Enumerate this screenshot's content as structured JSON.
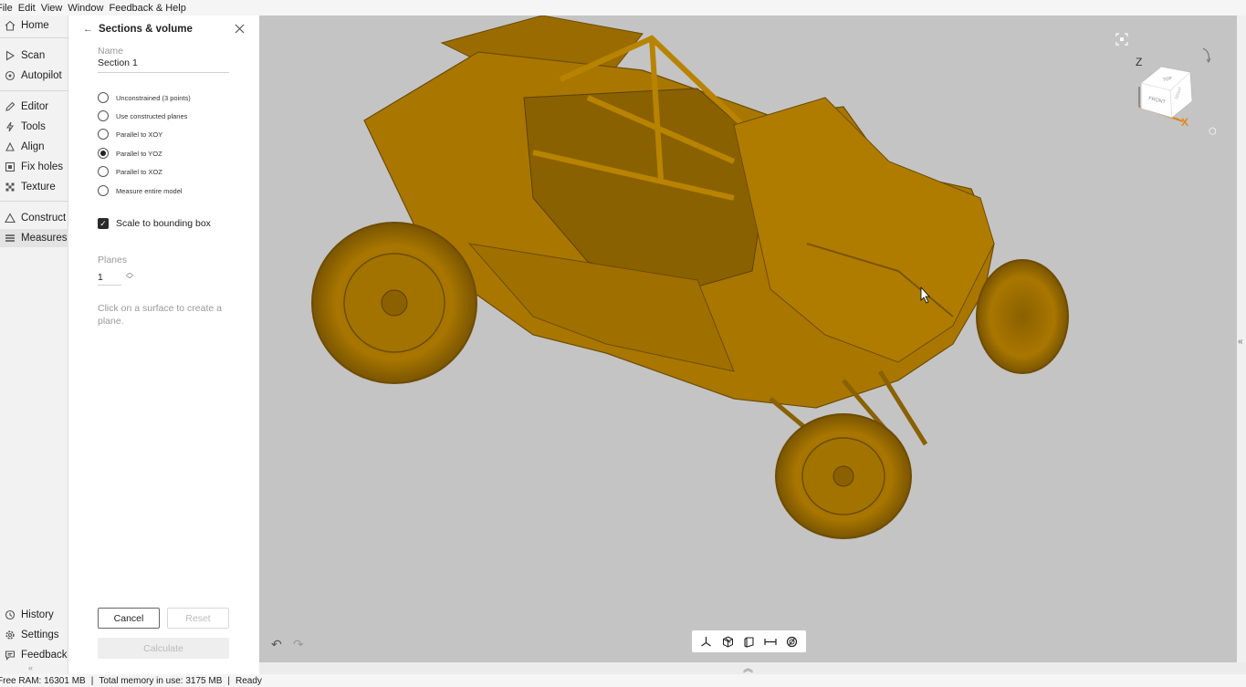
{
  "menu": {
    "items": [
      "File",
      "Edit",
      "View",
      "Window",
      "Feedback & Help"
    ]
  },
  "nav": {
    "home": "Home",
    "scan": "Scan",
    "autopilot": "Autopilot",
    "editor": "Editor",
    "tools": "Tools",
    "align": "Align",
    "fix_holes": "Fix holes",
    "texture": "Texture",
    "construct": "Construct",
    "measures": "Measures",
    "history": "History",
    "settings": "Settings",
    "feedback": "Feedback",
    "active": "Measures"
  },
  "panel": {
    "title": "Sections & volume",
    "name_label": "Name",
    "name_value": "Section 1",
    "options": [
      {
        "label": "Unconstrained (3 points)",
        "checked": false
      },
      {
        "label": "Use constructed planes",
        "checked": false
      },
      {
        "label": "Parallel to XOY",
        "checked": false
      },
      {
        "label": "Parallel to YOZ",
        "checked": true
      },
      {
        "label": "Parallel to XOZ",
        "checked": false
      },
      {
        "label": "Measure entire model",
        "checked": false
      }
    ],
    "scale_label": "Scale to bounding box",
    "scale_checked": true,
    "planes_label": "Planes",
    "planes_value": "1",
    "hint": "Click on a surface to create a plane.",
    "cancel": "Cancel",
    "reset": "Reset",
    "calculate": "Calculate"
  },
  "viewcube": {
    "axis_z": "Z",
    "axis_x": "X",
    "face_top": "TOP",
    "face_front": "FRONT",
    "face_right": "RIGHT"
  },
  "colors": {
    "model": "#a97700",
    "viewport": "#c4c4c4",
    "axis_x": "#e08a1e"
  },
  "status": {
    "free_ram": "Free RAM: 16301 MB",
    "total_memory": "Total memory in use: 3175 MB",
    "state": "Ready"
  }
}
